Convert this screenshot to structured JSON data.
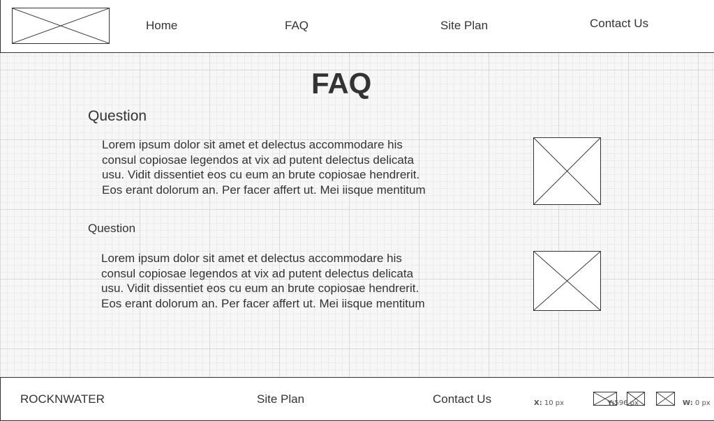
{
  "header": {
    "nav": [
      "Home",
      "FAQ",
      "Site Plan",
      "Contact Us"
    ]
  },
  "main": {
    "title": "FAQ",
    "questions": [
      {
        "title": "Question",
        "lines": [
          "Lorem ipsum dolor sit amet et delectus accommodare his",
          "consul copiosae legendos at vix ad putent delectus delicata",
          "usu. Vidit dissentiet eos cu eum an brute copiosae hendrerit.",
          "Eos erant dolorum an. Per facer affert ut. Mei iisque mentitum"
        ]
      },
      {
        "title": "Question",
        "lines": [
          "Lorem ipsum dolor sit amet et delectus accommodare his",
          "consul copiosae legendos at vix ad putent delectus delicata",
          "usu. Vidit dissentiet eos cu eum an brute copiosae hendrerit.",
          "Eos erant dolorum an. Per facer affert ut. Mei iisque mentitum"
        ]
      }
    ]
  },
  "footer": {
    "brand": "ROCKNWATER",
    "links": [
      "Site Plan",
      "Contact Us"
    ],
    "coords": {
      "x_label": "X:",
      "x_value": "10 px",
      "y_label": "Y:",
      "y_value": "596 px",
      "w_label": "W:",
      "w_value": "0 px"
    }
  }
}
